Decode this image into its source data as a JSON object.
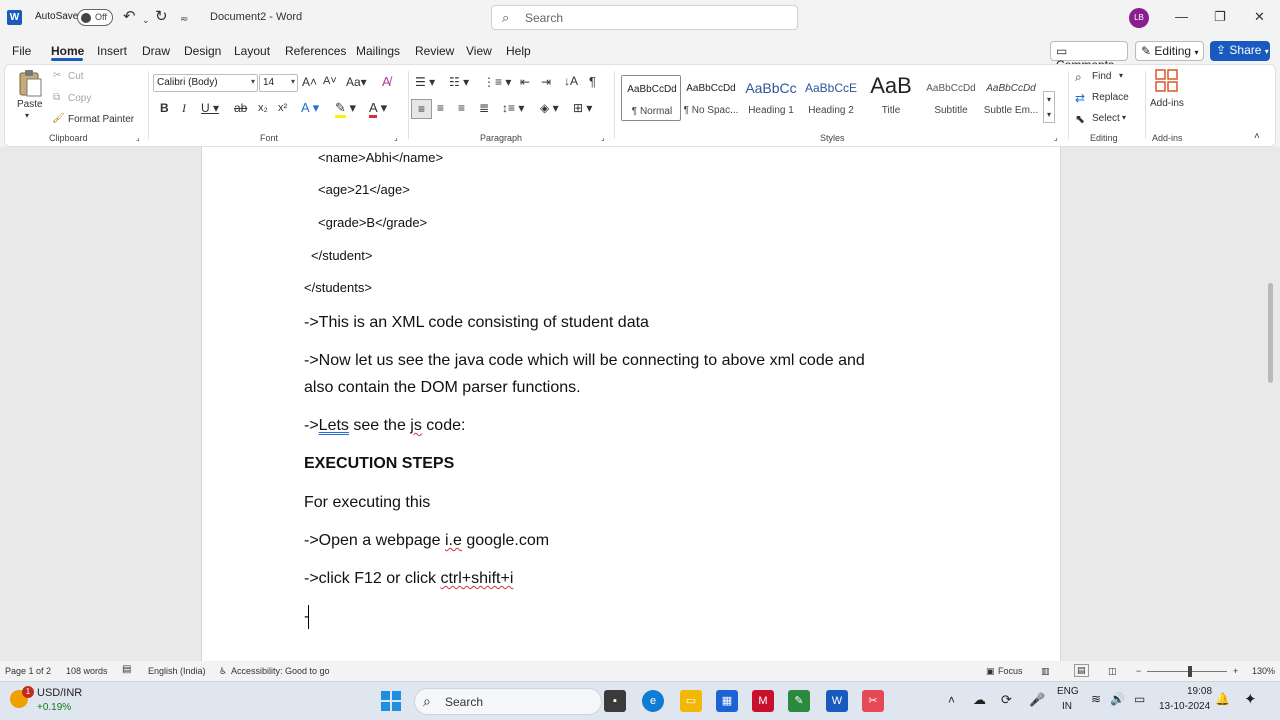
{
  "titlebar": {
    "autosave_label": "AutoSave",
    "autosave_state": "Off",
    "doc_title": "Document2  -  Word",
    "search_placeholder": "Search",
    "user_initials": "LB"
  },
  "menu": {
    "tabs": [
      "File",
      "Home",
      "Insert",
      "Draw",
      "Design",
      "Layout",
      "References",
      "Mailings",
      "Review",
      "View",
      "Help"
    ],
    "active_tab": "Home",
    "comments": "Comments",
    "editing": "Editing",
    "share": "Share"
  },
  "ribbon": {
    "clipboard": {
      "paste": "Paste",
      "cut": "Cut",
      "copy": "Copy",
      "format_painter": "Format Painter",
      "label": "Clipboard"
    },
    "font": {
      "family": "Calibri (Body)",
      "size": "14",
      "label": "Font"
    },
    "paragraph": {
      "label": "Paragraph"
    },
    "styles": {
      "items": [
        {
          "preview": "AaBbCcDd",
          "name": "¶ Normal"
        },
        {
          "preview": "AaBbCcDd",
          "name": "¶ No Spac..."
        },
        {
          "preview": "AaBbCc",
          "name": "Heading 1"
        },
        {
          "preview": "AaBbCcE",
          "name": "Heading 2"
        },
        {
          "preview": "AaB",
          "name": "Title"
        },
        {
          "preview": "AaBbCcDd",
          "name": "Subtitle"
        },
        {
          "preview": "AaBbCcDd",
          "name": "Subtle Em..."
        }
      ],
      "label": "Styles"
    },
    "editing": {
      "find": "Find",
      "replace": "Replace",
      "select": "Select",
      "label": "Editing"
    },
    "addins": {
      "button": "Add-ins",
      "label": "Add-ins"
    }
  },
  "document": {
    "lines": [
      "<name>Abhi</name>",
      "<age>21</age>",
      "<grade>B</grade>",
      "</student>",
      "</students>",
      "->This is an XML code consisting of student data",
      "->Now let us see the java code which will be connecting to above xml code and",
      "also contain the DOM parser functions.",
      "->",
      "Lets",
      " see the ",
      "js",
      " code:",
      "EXECUTION STEPS",
      "For executing this",
      "->Open a webpage ",
      "i.e",
      " google.com",
      "->click F12 or click ",
      "ctrl+shift+i",
      "-"
    ]
  },
  "status": {
    "page": "Page 1 of 2",
    "words": "108 words",
    "language": "English (India)",
    "accessibility": "Accessibility: Good to go",
    "focus": "Focus",
    "zoom": "130%"
  },
  "taskbar": {
    "ticker": "USD/INR",
    "ticker_change": "+0.19%",
    "ticker_badge": "1",
    "search": "Search",
    "lang1": "ENG",
    "lang2": "IN",
    "time": "19:08",
    "date": "13-10-2024"
  }
}
